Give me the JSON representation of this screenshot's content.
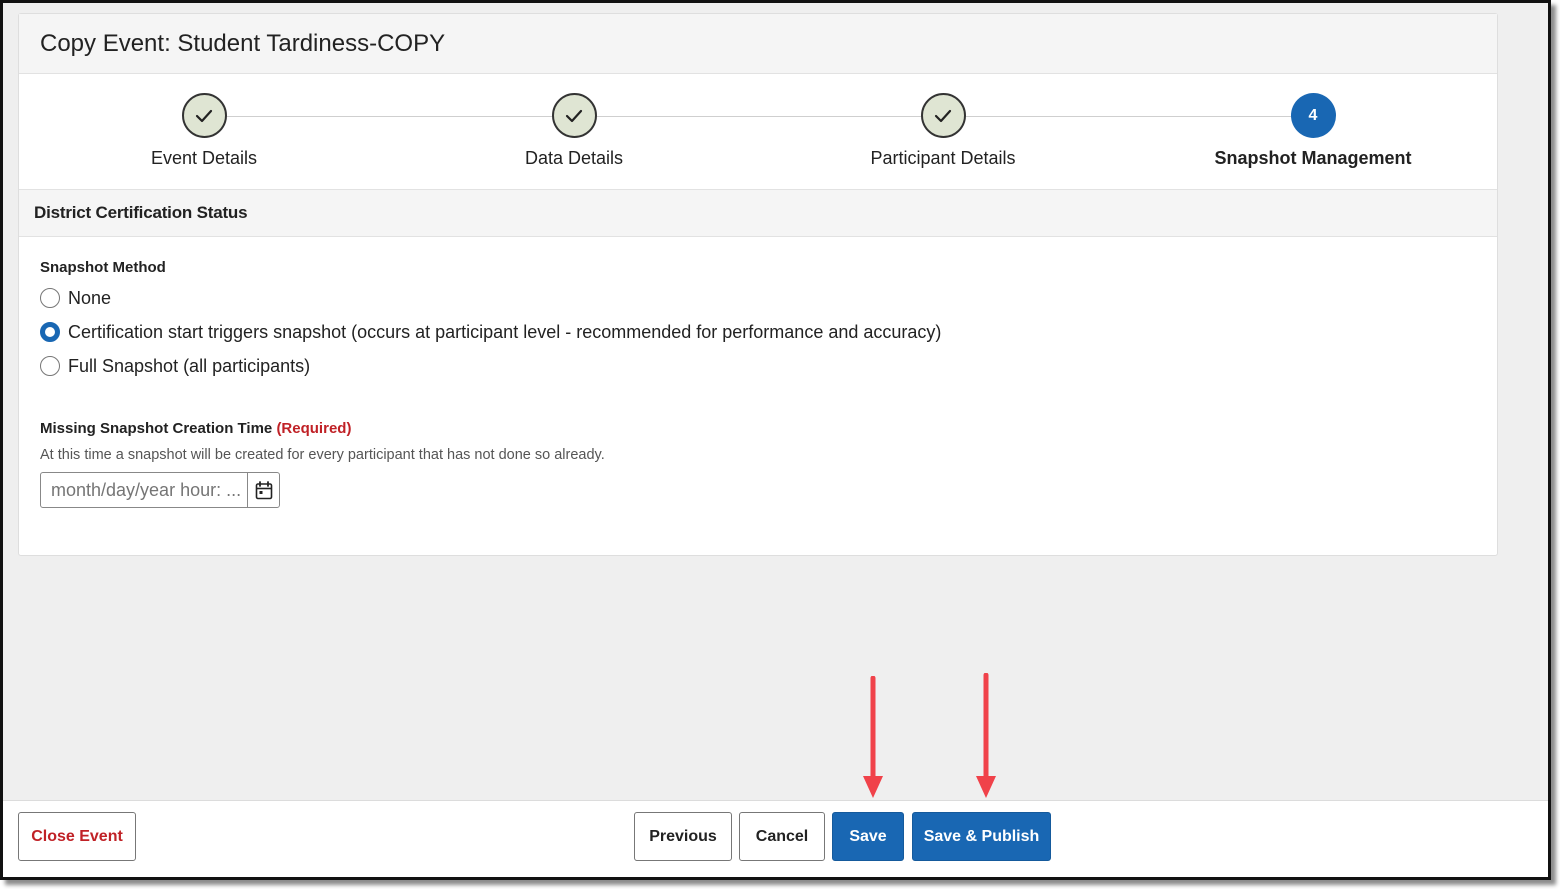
{
  "page": {
    "title": "Copy Event: Student Tardiness-COPY"
  },
  "stepper": {
    "steps": [
      {
        "label": "Event Details",
        "state": "complete",
        "marker": ""
      },
      {
        "label": "Data Details",
        "state": "complete",
        "marker": ""
      },
      {
        "label": "Participant Details",
        "state": "complete",
        "marker": ""
      },
      {
        "label": "Snapshot Management",
        "state": "active",
        "marker": "4"
      }
    ]
  },
  "section": {
    "title": "District Certification Status"
  },
  "snapshot_method": {
    "label": "Snapshot Method",
    "options": [
      {
        "label": "None",
        "checked": false
      },
      {
        "label": "Certification start triggers snapshot (occurs at participant level - recommended for performance and accuracy)",
        "checked": true
      },
      {
        "label": "Full Snapshot (all participants)",
        "checked": false
      }
    ]
  },
  "missing_snapshot": {
    "label": "Missing Snapshot Creation Time",
    "required_text": "(Required)",
    "help_text": "At this time a snapshot will be created for every participant that has not done so already.",
    "placeholder": "month/day/year hour: ...",
    "value": ""
  },
  "footer": {
    "close_label": "Close Event",
    "previous_label": "Previous",
    "cancel_label": "Cancel",
    "save_label": "Save",
    "save_publish_label": "Save & Publish"
  },
  "colors": {
    "primary": "#1967b3",
    "danger": "#c02126",
    "complete_step_bg": "#dfe5d3",
    "annotation_arrow": "#f0424a"
  },
  "icons": {
    "complete_step": "check-icon",
    "date_picker": "calendar-icon",
    "annotations": "down-arrow-icon"
  }
}
